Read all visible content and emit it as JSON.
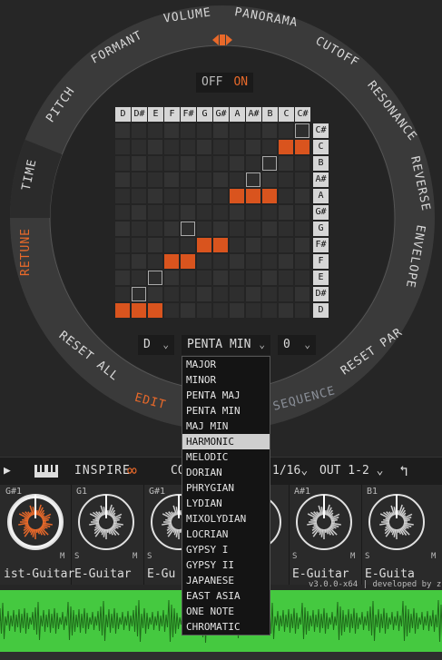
{
  "ring": {
    "labels": [
      "VOLUME",
      "PANORAMA",
      "CUTOFF",
      "RESONANCE",
      "REVERSE",
      "ENVELOPE",
      "RESET PAR",
      "SEQUENCE",
      "EDIT",
      "RESET ALL",
      "RETUNE",
      "TIME",
      "PITCH",
      "FORMANT"
    ],
    "active_label": "RETUNE"
  },
  "toggle": {
    "off": "OFF",
    "on": "ON",
    "state": "ON"
  },
  "grid": {
    "columns": [
      "D",
      "D#",
      "E",
      "F",
      "F#",
      "G",
      "G#",
      "A",
      "A#",
      "B",
      "C",
      "C#"
    ],
    "rows": [
      "C#",
      "C",
      "B",
      "A#",
      "A",
      "G#",
      "G",
      "F#",
      "F",
      "E",
      "D#",
      "D"
    ],
    "accent": "#d9541e"
  },
  "controls": {
    "root": "D",
    "scale": "PENTA MIN",
    "octave": "0"
  },
  "scale_list": {
    "items": [
      "MAJOR",
      "MINOR",
      "PENTA MAJ",
      "PENTA MIN",
      "MAJ MIN",
      "HARMONIC",
      "MELODIC",
      "DORIAN",
      "PHRYGIAN",
      "LYDIAN",
      "MIXOLYDIAN",
      "LOCRIAN",
      "GYPSY I",
      "GYPSY II",
      "JAPANESE",
      "EAST ASIA",
      "ONE NOTE",
      "CHROMATIC"
    ],
    "highlighted": "HARMONIC"
  },
  "toolbar": {
    "play": "▶",
    "inspire": "INSPIRE",
    "inspire_symbol": "∞",
    "co": "CO",
    "rate": "1/16",
    "out": "OUT 1-2",
    "undo_icon": "undo-icon"
  },
  "channels": [
    {
      "note": "G#1",
      "name": "ist-Guitar",
      "s": "",
      "m": "M"
    },
    {
      "note": "G1",
      "name": "E-Guitar",
      "s": "S",
      "m": "M"
    },
    {
      "note": "G#1",
      "name": "E-Gu",
      "s": "S",
      "m": ""
    },
    {
      "note": "",
      "name": "tar",
      "s": "",
      "m": ""
    },
    {
      "note": "A#1",
      "name": "E-Guitar",
      "s": "S",
      "m": "M"
    },
    {
      "note": "B1",
      "name": "E-Guita",
      "s": "S",
      "m": "M"
    }
  ],
  "version": "v3.0.0-x64 | developed by zp"
}
